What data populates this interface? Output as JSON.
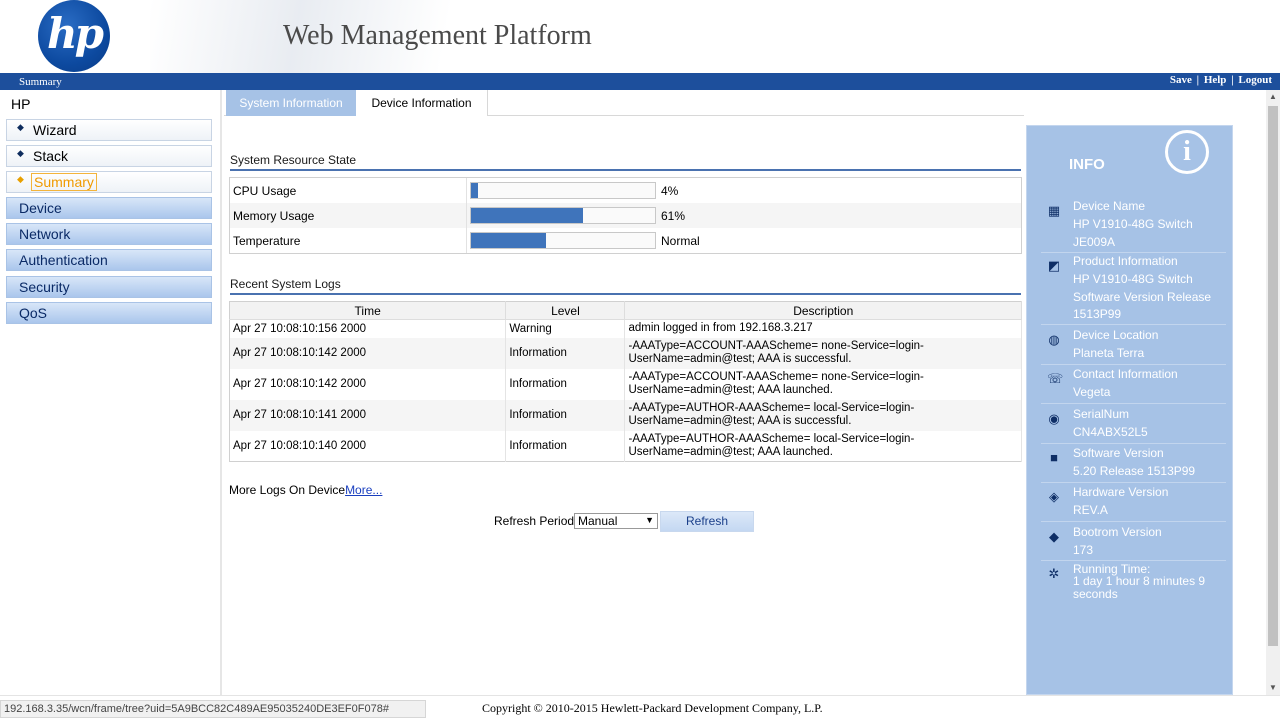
{
  "header": {
    "logo_text": "hp",
    "title": "Web Management Platform",
    "breadcrumb": "Summary",
    "links": {
      "save": "Save",
      "help": "Help",
      "logout": "Logout",
      "separator": "|"
    }
  },
  "sidebar": {
    "root": "HP",
    "sub_items": [
      {
        "label": "Wizard"
      },
      {
        "label": "Stack"
      },
      {
        "label": "Summary",
        "active": true
      }
    ],
    "groups": [
      {
        "label": "Device"
      },
      {
        "label": "Network"
      },
      {
        "label": "Authentication"
      },
      {
        "label": "Security"
      },
      {
        "label": "QoS"
      }
    ]
  },
  "tabs": [
    {
      "label": "System Information",
      "active": true
    },
    {
      "label": "Device Information",
      "active": false
    }
  ],
  "resource": {
    "title": "System Resource State",
    "rows": [
      {
        "label": "CPU Usage",
        "value": "4%",
        "fill": 0.04
      },
      {
        "label": "Memory Usage",
        "value": "61%",
        "fill": 0.61
      },
      {
        "label": "Temperature",
        "value": "Normal",
        "fill": 0.41
      }
    ]
  },
  "logs": {
    "title": "Recent System Logs",
    "columns": [
      "Time",
      "Level",
      "Description"
    ],
    "rows": [
      {
        "time": "Apr 27 10:08:10:156 2000",
        "level": "Warning",
        "desc1": "admin logged in from 192.168.3.217",
        "desc2": ""
      },
      {
        "time": "Apr 27 10:08:10:142 2000",
        "level": "Information",
        "desc1": "-AAAType=ACCOUNT-AAAScheme= none-Service=login-",
        "desc2": "UserName=admin@test; AAA is successful."
      },
      {
        "time": "Apr 27 10:08:10:142 2000",
        "level": "Information",
        "desc1": "-AAAType=ACCOUNT-AAAScheme= none-Service=login-",
        "desc2": "UserName=admin@test; AAA launched."
      },
      {
        "time": "Apr 27 10:08:10:141 2000",
        "level": "Information",
        "desc1": "-AAAType=AUTHOR-AAAScheme= local-Service=login-",
        "desc2": "UserName=admin@test; AAA is successful."
      },
      {
        "time": "Apr 27 10:08:10:140 2000",
        "level": "Information",
        "desc1": "-AAAType=AUTHOR-AAAScheme= local-Service=login-",
        "desc2": "UserName=admin@test; AAA launched."
      }
    ],
    "more_prefix": "More Logs On Device",
    "more_link": "More..."
  },
  "refresh": {
    "label": "Refresh Period",
    "selected": "Manual",
    "button": "Refresh"
  },
  "info": {
    "title": "INFO",
    "icon_glyph": "i",
    "items": [
      {
        "name": "Device Name",
        "value": [
          "HP V1910-48G Switch",
          "JE009A"
        ],
        "icon": "switch-icon"
      },
      {
        "name": "Product Information",
        "value": [
          "HP V1910-48G Switch",
          "Software Version Release",
          "1513P99"
        ],
        "icon": "product-icon"
      },
      {
        "name": "Device Location",
        "value": [
          "Planeta Terra"
        ],
        "icon": "location-icon"
      },
      {
        "name": "Contact Information",
        "value": [
          "Vegeta"
        ],
        "icon": "contact-icon"
      },
      {
        "name": "SerialNum",
        "value": [
          "CN4ABX52L5"
        ],
        "icon": "serial-icon"
      },
      {
        "name": "Software Version",
        "value": [
          "5.20 Release 1513P99"
        ],
        "icon": "software-icon"
      },
      {
        "name": "Hardware Version",
        "value": [
          "REV.A"
        ],
        "icon": "hardware-icon"
      },
      {
        "name": "Bootrom Version",
        "value": [
          "173"
        ],
        "icon": "bootrom-icon"
      },
      {
        "name": "Running Time:",
        "value": [
          "1 day 1 hour 8 minutes 9",
          "seconds"
        ],
        "icon": "running-time-icon"
      }
    ]
  },
  "footer": {
    "status_url": "192.168.3.35/wcn/frame/tree?uid=5A9BCC82C489AE95035240DE3EF0F078#",
    "copyright": "Copyright © 2010-2015 Hewlett-Packard Development Company, L.P."
  },
  "colors": {
    "brand_blue": "#1d4f9c",
    "panel_blue": "#a6c2e6",
    "bar_blue": "#3f74bb",
    "active_orange": "#f09a00"
  }
}
